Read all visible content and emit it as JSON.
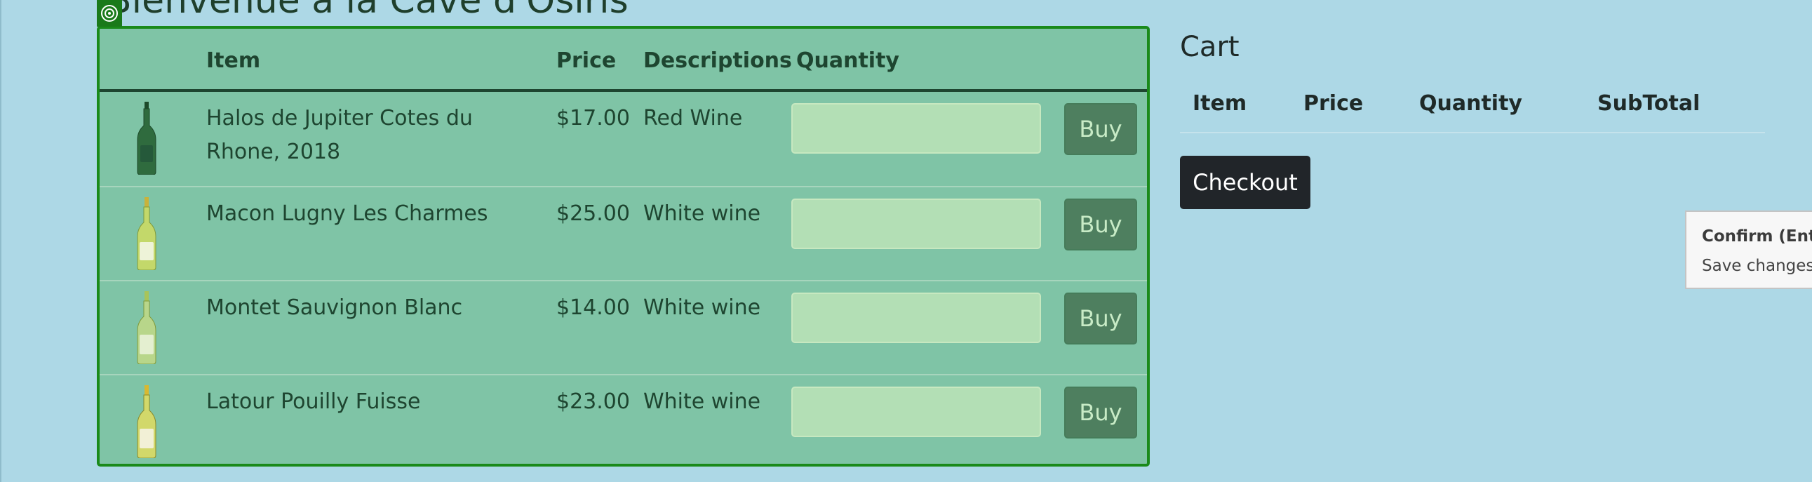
{
  "page": {
    "title": "Bienvenue à la Cave d'Osiris"
  },
  "products": {
    "headers": {
      "item": "Item",
      "price": "Price",
      "descriptions": "Descriptions",
      "quantity": "Quantity"
    },
    "rows": [
      {
        "name": "Halos de Jupiter Cotes du Rhone, 2018",
        "price": "$17.00",
        "description": "Red Wine",
        "quantity": "",
        "buy_label": "Buy",
        "bottle": "red-wine-bottle-icon"
      },
      {
        "name": "Macon Lugny Les Charmes",
        "price": "$25.00",
        "description": "White wine",
        "quantity": "",
        "buy_label": "Buy",
        "bottle": "white-wine-bottle-icon"
      },
      {
        "name": "Montet Sauvignon Blanc",
        "price": "$14.00",
        "description": "White wine",
        "quantity": "",
        "buy_label": "Buy",
        "bottle": "white-wine-bottle-icon"
      },
      {
        "name": "Latour Pouilly Fuisse",
        "price": "$23.00",
        "description": "White wine",
        "quantity": "",
        "buy_label": "Buy",
        "bottle": "white-wine-bottle-icon"
      }
    ]
  },
  "cart": {
    "title": "Cart",
    "headers": {
      "item": "Item",
      "price": "Price",
      "quantity": "Quantity",
      "subtotal": "SubTotal"
    },
    "checkout_label": "Checkout"
  },
  "tooltip": {
    "title": "Confirm (Ente",
    "body": "Save changes a"
  },
  "colors": {
    "page_background": "#add8e6",
    "table_background": "#7fc4a6",
    "table_border": "#1a8a1a",
    "input_background": "#b3dfb5",
    "buy_button": "#4e7f5f",
    "checkout_button": "#212529"
  }
}
